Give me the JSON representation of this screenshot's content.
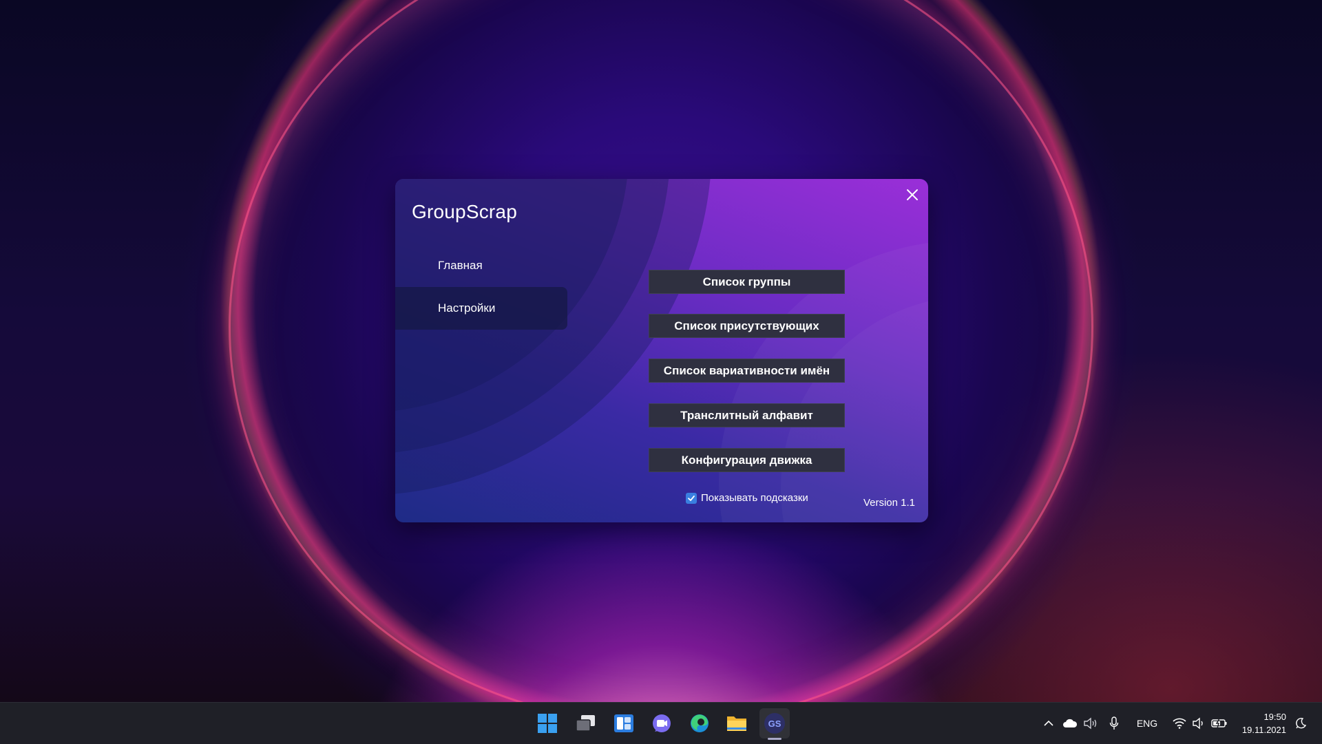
{
  "app": {
    "title": "GroupScrap",
    "nav": [
      {
        "label": "Главная"
      },
      {
        "label": "Настройки"
      }
    ],
    "buttons": [
      {
        "label": "Список группы"
      },
      {
        "label": "Список присутствующих"
      },
      {
        "label": "Список вариативности имён"
      },
      {
        "label": "Транслитный алфавит"
      },
      {
        "label": "Конфигурация движка"
      }
    ],
    "hints_checkbox": {
      "label": "Показывать подсказки",
      "checked": true
    },
    "version": "Version 1.1",
    "icons": {
      "close": "close-icon",
      "checkbox": "checkmark-icon"
    }
  },
  "taskbar": {
    "apps": [
      "windows-start-icon",
      "task-view-icon",
      "widgets-icon",
      "teams-chat-icon",
      "edge-icon",
      "file-explorer-icon",
      "groupscrap-icon"
    ],
    "groupscrap_badge": "GS",
    "tray": {
      "language": "ENG",
      "time": "19:50",
      "date": "19.11.2021"
    }
  },
  "colors": {
    "accent": "#3a7fe0",
    "button_bg": "#2f3040",
    "taskbar_bg": "#1f2027"
  }
}
